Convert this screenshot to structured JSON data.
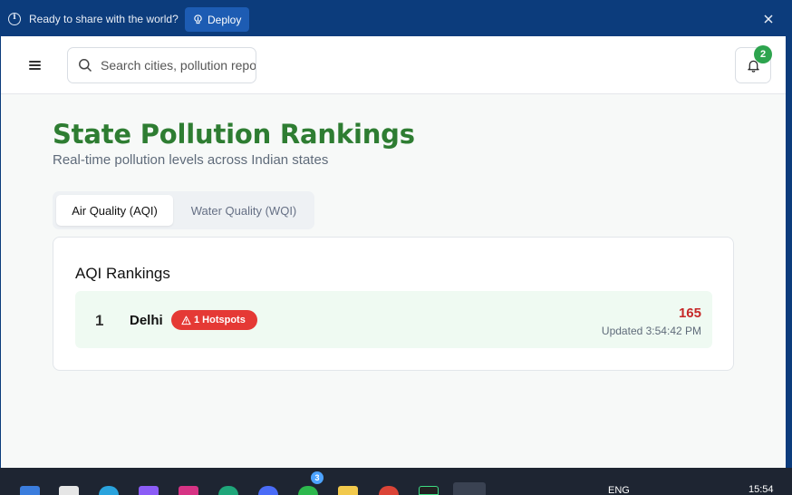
{
  "banner": {
    "message": "Ready to share with the world?",
    "deploy_label": "Deploy"
  },
  "header": {
    "search_placeholder": "Search cities, pollution reports...",
    "notification_count": "2"
  },
  "page": {
    "title": "State Pollution Rankings",
    "subtitle": "Real-time pollution levels across Indian states"
  },
  "tabs": [
    {
      "label": "Air Quality (AQI)",
      "active": true
    },
    {
      "label": "Water Quality (WQI)",
      "active": false
    }
  ],
  "rankings": {
    "title": "AQI Rankings",
    "rows": [
      {
        "rank": "1",
        "state": "Delhi",
        "hotspots": "1 Hotspots",
        "value": "165",
        "updated": "Updated 3:54:42 PM"
      }
    ]
  },
  "taskbar": {
    "badge": "3",
    "language": "ENG",
    "time": "15:54"
  },
  "colors": {
    "accent_green": "#2e7d32",
    "banner_blue": "#0c3c7c",
    "hotspot_red": "#e53935",
    "value_red": "#c62828"
  }
}
